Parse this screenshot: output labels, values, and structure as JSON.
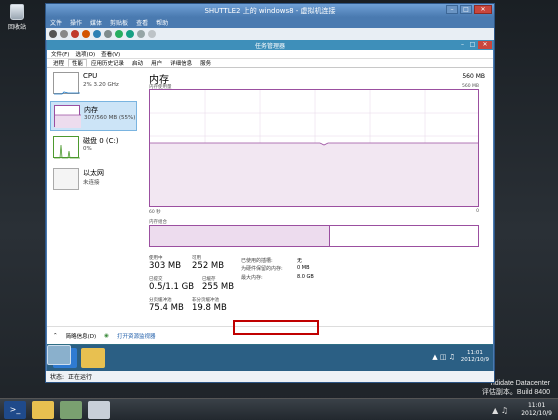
{
  "host": {
    "recycle_bin": "回收站",
    "watermark_line1": "ndidate Datacenter",
    "watermark_line2": "评估副本。Build 8400",
    "clock_time": "11:01",
    "clock_date": "2012/10/9"
  },
  "vm": {
    "title": "SHUTTLE2 上的 windows8 - 虚拟机连接",
    "menu": [
      "文件",
      "操作",
      "媒体",
      "剪贴板",
      "查看",
      "帮助"
    ],
    "status_label": "状态:",
    "status_value": "正在运行"
  },
  "taskmgr": {
    "title": "任务管理器",
    "menu": [
      "文件(F)",
      "选项(O)",
      "查看(V)"
    ],
    "tabs": [
      "进程",
      "性能",
      "应用历史记录",
      "启动",
      "用户",
      "详细信息",
      "服务"
    ],
    "active_tab": "性能",
    "sidebar": [
      {
        "name": "CPU",
        "sub": "2% 3.20 GHz"
      },
      {
        "name": "内存",
        "sub": "307/560 MB (55%)"
      },
      {
        "name": "磁盘 0 (C:)",
        "sub": "0%"
      },
      {
        "name": "以太网",
        "sub": "未连接"
      }
    ],
    "main": {
      "title": "内存",
      "total": "560 MB",
      "graph_label_left": "内存使用量",
      "graph_label_right": "560 MB",
      "time_label": "60 秒",
      "zero_label": "0",
      "composition_label": "内存组合",
      "stats": {
        "in_use_label": "使用中",
        "in_use_value": "303 MB",
        "available_label": "可用",
        "available_value": "252 MB",
        "committed_label": "已提交",
        "committed_value": "0.5/1.1 GB",
        "cached_label": "已缓存",
        "cached_value": "255 MB",
        "paged_label": "分页缓冲池",
        "paged_value": "75.4 MB",
        "nonpaged_label": "非分页缓冲池",
        "nonpaged_value": "19.8 MB"
      },
      "details": [
        {
          "k": "已使用的插槽:",
          "v": "无"
        },
        {
          "k": "为硬件保留的内存:",
          "v": "0 MB"
        },
        {
          "k": "最大内存:",
          "v": "8.0 GB"
        }
      ]
    },
    "footer": {
      "fewer_details": "简略信息(D)",
      "open_monitor": "打开资源监视器"
    }
  },
  "guest": {
    "clock_time": "11:01",
    "clock_date": "2012/10/9"
  }
}
